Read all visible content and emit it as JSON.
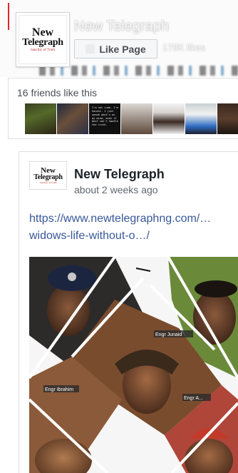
{
  "page": {
    "name": "New Telegraph",
    "logo": {
      "line1": "New",
      "line2": "Telegraph",
      "tagline": "Sanctity of Truth"
    },
    "like_button_label": "Like Page",
    "likes_count": "179K likes"
  },
  "friends": {
    "text": "16 friends like this",
    "quote_text": "I'm not rude, I'm honest. I just speak what's on my mind, even if most can't handle the truth."
  },
  "post": {
    "author": "New Telegraph",
    "timestamp": "about 2 weeks ago",
    "link_line1": "https://www.newtelegraphng.com/…",
    "link_line2": "widows-life-without-o…/",
    "image_captions": [
      "Engr Ibrahim",
      "Engr Junaid",
      "Engr A..."
    ]
  },
  "colors": {
    "link": "#385898",
    "accent_red": "#e0262b",
    "text_secondary": "#606770"
  }
}
